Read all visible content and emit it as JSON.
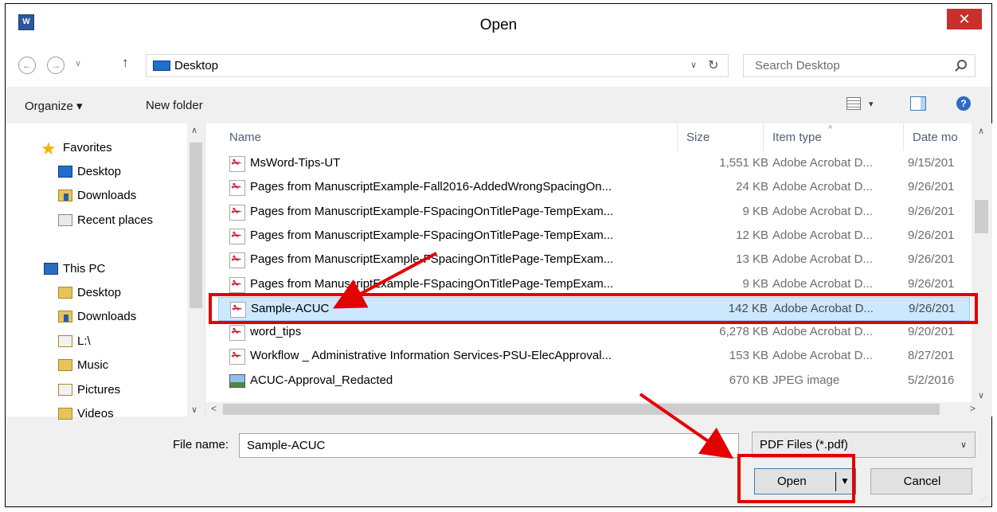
{
  "window": {
    "title": "Open",
    "app_icon": "word-icon",
    "close_glyph": "✕"
  },
  "nav": {
    "back_glyph": "←",
    "forward_glyph": "→",
    "recent_glyph": "∨",
    "up_glyph": "↑",
    "address": "Desktop",
    "address_chevron": "∨",
    "refresh_glyph": "↻",
    "search_placeholder": "Search Desktop"
  },
  "toolbar": {
    "organize": "Organize ▾",
    "new_folder": "New folder",
    "view_chevron": "▾",
    "help_glyph": "?"
  },
  "sidebar": {
    "favorites_label": "Favorites",
    "favorites": [
      {
        "label": "Desktop",
        "icon": "desktop-icon"
      },
      {
        "label": "Downloads",
        "icon": "downloads-icon"
      },
      {
        "label": "Recent places",
        "icon": "recent-places-icon"
      }
    ],
    "this_pc_label": "This PC",
    "this_pc": [
      {
        "label": "Desktop",
        "icon": "desktop-icon"
      },
      {
        "label": "Downloads",
        "icon": "downloads-icon"
      },
      {
        "label": "L:\\",
        "icon": "drive-icon"
      },
      {
        "label": "Music",
        "icon": "music-icon"
      },
      {
        "label": "Pictures",
        "icon": "pictures-icon"
      },
      {
        "label": "Videos",
        "icon": "videos-icon"
      }
    ]
  },
  "columns": {
    "name": "Name",
    "size": "Size",
    "type": "Item type",
    "date": "Date mo"
  },
  "files": [
    {
      "name": "MsWord-Tips-UT",
      "size": "1,551 KB",
      "type": "Adobe Acrobat D...",
      "date": "9/15/201",
      "icon": "pdf-icon"
    },
    {
      "name": "Pages from ManuscriptExample-Fall2016-AddedWrongSpacingOn...",
      "size": "24 KB",
      "type": "Adobe Acrobat D...",
      "date": "9/26/201",
      "icon": "pdf-icon"
    },
    {
      "name": "Pages from ManuscriptExample-FSpacingOnTitlePage-TempExam...",
      "size": "9 KB",
      "type": "Adobe Acrobat D...",
      "date": "9/26/201",
      "icon": "pdf-icon"
    },
    {
      "name": "Pages from ManuscriptExample-FSpacingOnTitlePage-TempExam...",
      "size": "12 KB",
      "type": "Adobe Acrobat D...",
      "date": "9/26/201",
      "icon": "pdf-icon"
    },
    {
      "name": "Pages from ManuscriptExample-FSpacingOnTitlePage-TempExam...",
      "size": "13 KB",
      "type": "Adobe Acrobat D...",
      "date": "9/26/201",
      "icon": "pdf-icon"
    },
    {
      "name": "Pages from ManuscriptExample-FSpacingOnTitlePage-TempExam...",
      "size": "9 KB",
      "type": "Adobe Acrobat D...",
      "date": "9/26/201",
      "icon": "pdf-icon"
    },
    {
      "name": "Sample-ACUC",
      "size": "142 KB",
      "type": "Adobe Acrobat D...",
      "date": "9/26/201",
      "icon": "pdf-icon",
      "selected": true
    },
    {
      "name": "word_tips",
      "size": "6,278 KB",
      "type": "Adobe Acrobat D...",
      "date": "9/20/201",
      "icon": "pdf-icon"
    },
    {
      "name": "Workflow _ Administrative Information Services-PSU-ElecApproval...",
      "size": "153 KB",
      "type": "Adobe Acrobat D...",
      "date": "8/27/201",
      "icon": "pdf-icon"
    },
    {
      "name": "ACUC-Approval_Redacted",
      "size": "670 KB",
      "type": "JPEG image",
      "date": "5/2/2016",
      "icon": "image-icon"
    }
  ],
  "footer": {
    "file_name_label": "File name:",
    "file_name_value": "Sample-ACUC",
    "file_type": "PDF Files (*.pdf)",
    "file_type_chevron": "∨",
    "open_label": "Open",
    "open_dropdown_glyph": "▼",
    "cancel_label": "Cancel"
  },
  "colors": {
    "annotation_red": "#e40000",
    "selection_bg": "#cce8ff",
    "close_red": "#c7302b",
    "word_blue": "#2b579a"
  }
}
